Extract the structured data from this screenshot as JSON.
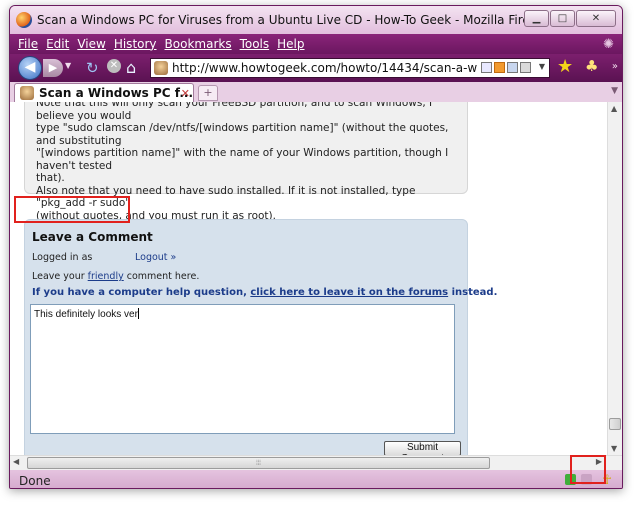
{
  "window": {
    "title": "Scan a Windows PC for Viruses from a Ubuntu Live CD - How-To Geek - Mozilla Firefox",
    "minimize_glyph": "▁",
    "maximize_glyph": "□",
    "close_glyph": "✕"
  },
  "menu": {
    "items": [
      "File",
      "Edit",
      "View",
      "History",
      "Bookmarks",
      "Tools",
      "Help"
    ]
  },
  "navigation": {
    "url": "http://www.howtogeek.com/howto/14434/scan-a-windows-"
  },
  "tabs": {
    "active_title": "Scan a Windows PC f...",
    "close_glyph": "✕",
    "new_tab_glyph": "+"
  },
  "article": {
    "lines": [
      "Note that this will only scan your FreeBSD partition, and to scan Windows, I believe you would",
      "type \"sudo clamscan /dev/ntfs/[windows partition name]\" (without the quotes, and substituting",
      "\"[windows partition name]\" with the name of your Windows partition, though I haven't tested",
      "that).",
      "Also note that you need to have sudo installed. If it is not installed, type \"pkg_add -r sudo\"",
      "(without quotes, and you must run it as root)."
    ]
  },
  "comment": {
    "heading": "Leave a Comment",
    "logged_in_label": "Logged in as",
    "logout_label": "Logout »",
    "leave_prefix": "Leave your ",
    "leave_link": "friendly",
    "leave_suffix": " comment here.",
    "help_prefix": "If you have a computer help question, ",
    "help_link": "click here to leave it on the forums",
    "help_suffix": " instead.",
    "textarea_value": "This definitely looks ver",
    "submit_label": "Submit Comment"
  },
  "status": {
    "text": "Done"
  },
  "colors": {
    "menubar": "#7c1f6e",
    "highlight": "#e1211d",
    "comment_bg": "#d6e1ec",
    "link": "#1c3c8a"
  }
}
